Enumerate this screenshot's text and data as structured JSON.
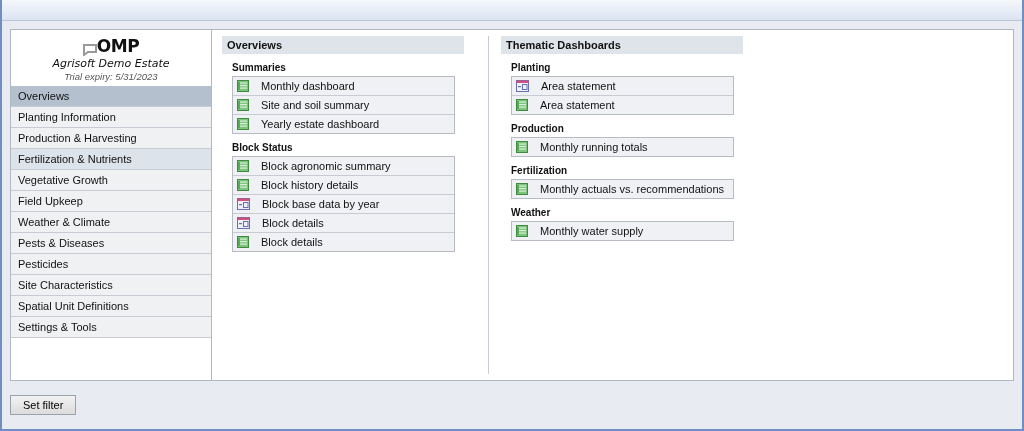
{
  "logo": {
    "text": "OMP"
  },
  "estate": {
    "name": "Agrisoft Demo Estate",
    "trial": "Trial expiry: 5/31/2023"
  },
  "sidebar": {
    "items": [
      {
        "label": "Overviews",
        "selected": true,
        "hovered": false
      },
      {
        "label": "Planting Information",
        "selected": false,
        "hovered": false
      },
      {
        "label": "Production & Harvesting",
        "selected": false,
        "hovered": false
      },
      {
        "label": "Fertilization & Nutrients",
        "selected": false,
        "hovered": true
      },
      {
        "label": "Vegetative Growth",
        "selected": false,
        "hovered": false
      },
      {
        "label": "Field Upkeep",
        "selected": false,
        "hovered": false
      },
      {
        "label": "Weather & Climate",
        "selected": false,
        "hovered": false
      },
      {
        "label": "Pests & Diseases",
        "selected": false,
        "hovered": false
      },
      {
        "label": "Pesticides",
        "selected": false,
        "hovered": false
      },
      {
        "label": "Site Characteristics",
        "selected": false,
        "hovered": false
      },
      {
        "label": "Spatial Unit Definitions",
        "selected": false,
        "hovered": false
      },
      {
        "label": "Settings & Tools",
        "selected": false,
        "hovered": false
      }
    ]
  },
  "columns": [
    {
      "title": "Overviews",
      "groups": [
        {
          "title": "Summaries",
          "items": [
            {
              "label": "Monthly dashboard",
              "kind": "report"
            },
            {
              "label": "Site and soil summary",
              "kind": "report"
            },
            {
              "label": "Yearly estate dashboard",
              "kind": "report"
            }
          ]
        },
        {
          "title": "Block Status",
          "items": [
            {
              "label": "Block agronomic summary",
              "kind": "report"
            },
            {
              "label": "Block history details",
              "kind": "report"
            },
            {
              "label": "Block base data by year",
              "kind": "form"
            },
            {
              "label": "Block details",
              "kind": "form"
            },
            {
              "label": "Block details",
              "kind": "report"
            }
          ]
        }
      ]
    },
    {
      "title": "Thematic Dashboards",
      "groups": [
        {
          "title": "Planting",
          "items": [
            {
              "label": "Area statement",
              "kind": "form"
            },
            {
              "label": "Area statement",
              "kind": "report"
            }
          ]
        },
        {
          "title": "Production",
          "items": [
            {
              "label": "Monthly running totals",
              "kind": "report"
            }
          ]
        },
        {
          "title": "Fertilization",
          "items": [
            {
              "label": "Monthly actuals vs. recommendations",
              "kind": "report"
            }
          ]
        },
        {
          "title": "Weather",
          "items": [
            {
              "label": "Monthly water supply",
              "kind": "report"
            }
          ]
        }
      ]
    }
  ],
  "buttons": [
    {
      "label": "Set filter"
    }
  ]
}
